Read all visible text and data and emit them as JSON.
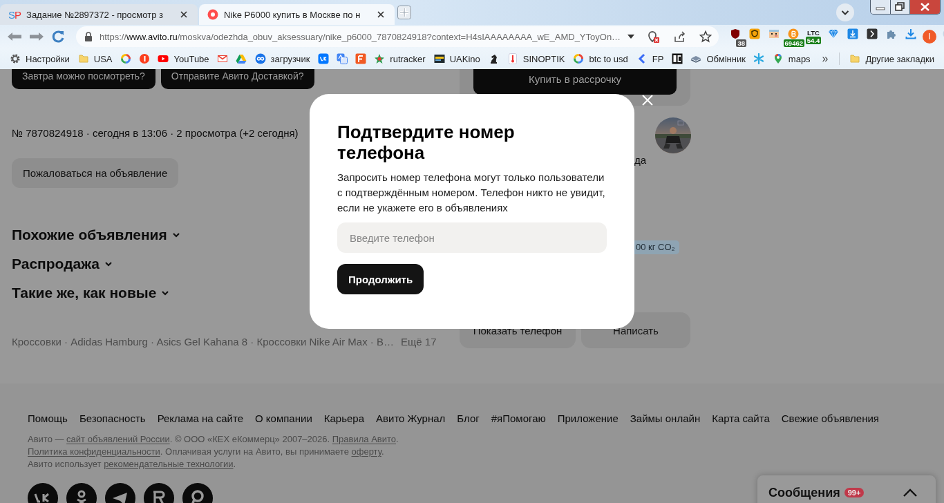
{
  "browser": {
    "tabs": [
      {
        "favicon_text": "SP",
        "title": "Задание №2897372 - просмотр з",
        "selected": false
      },
      {
        "title": "Nike P6000 купить в Москве по н",
        "selected": true
      }
    ],
    "address": {
      "scheme": "https://",
      "host": "www.avito.ru",
      "path": "/moskva/odezhda_obuv_aksessuary/nike_p6000_7870824918?context=H4sIAAAAAAAA_wE_AMD_YToyOn…"
    },
    "extensions": [
      {
        "kind": "badged",
        "badge": "38"
      },
      {
        "kind": "plain"
      },
      {
        "kind": "plain"
      },
      {
        "kind": "badged",
        "badge": "69462"
      },
      {
        "kind": "ticker",
        "label": "LTC",
        "badge": "54.4"
      },
      {
        "kind": "plain"
      },
      {
        "kind": "plain"
      },
      {
        "kind": "plain"
      },
      {
        "kind": "plain"
      },
      {
        "kind": "plain"
      },
      {
        "kind": "profile",
        "label": "I"
      },
      {
        "kind": "plain"
      }
    ],
    "bookmarks": [
      {
        "kind": "link",
        "label": "Настройки"
      },
      {
        "kind": "folder",
        "label": "USA"
      },
      {
        "kind": "icon"
      },
      {
        "kind": "icon"
      },
      {
        "kind": "link",
        "label": "YouTube"
      },
      {
        "kind": "icon"
      },
      {
        "kind": "icon"
      },
      {
        "kind": "link",
        "label": "загрузчик"
      },
      {
        "kind": "icon"
      },
      {
        "kind": "icon"
      },
      {
        "kind": "icon"
      },
      {
        "kind": "link",
        "label": "rutracker"
      },
      {
        "kind": "link",
        "label": "UAKino"
      },
      {
        "kind": "icon"
      },
      {
        "kind": "link",
        "label": "SINOPTIK"
      },
      {
        "kind": "link",
        "label": "btc to usd"
      },
      {
        "kind": "link",
        "label": "FP"
      },
      {
        "kind": "icon"
      },
      {
        "kind": "link",
        "label": "Обмінник"
      },
      {
        "kind": "icon"
      },
      {
        "kind": "link",
        "label": "maps"
      }
    ],
    "bookmarks_overflow": "»",
    "other_bookmarks": "Другие закладки"
  },
  "page": {
    "quick_questions": [
      "Завтра можно посмотреть?",
      "Отправите Авито Доставкой?"
    ],
    "listing_meta": "№ 7870824918 · сегодня в 13:06 · 2 просмотра (+2 сегодня)",
    "report_button": "Пожаловаться на объявление",
    "sections": [
      "Похожие объявления",
      "Распродажа",
      "Такие же, как новые"
    ],
    "tags": "Кроссовки · Adidas Hamburg · Asics Gel Kahana 8 · Кроссовки Nike Air Max · В…",
    "more_tags": "Ещё 17",
    "installment_button": "Купить в рассрочку",
    "seller_fragment": "да",
    "co2_badge": "00 кг CO₂",
    "show_phone_button": "Показать телефон",
    "write_button": "Написать"
  },
  "modal": {
    "title": "Подтвердите номер телефона",
    "text": "Запросить номер телефона могут только пользователи с подтверждённым номером. Телефон никто не увидит, если не укажете его в объявлениях",
    "phone_field": {
      "placeholder": "Введите телефон"
    },
    "continue_button": "Продолжить"
  },
  "footer": {
    "links": [
      "Помощь",
      "Безопасность",
      "Реклама на сайте",
      "О компании",
      "Карьера",
      "Авито Журнал",
      "Блог",
      "#яПомогаю",
      "Приложение",
      "Займы онлайн",
      "Карта сайта",
      "Свежие объявления"
    ],
    "legal": [
      [
        {
          "kind": "text",
          "text": "Авито — "
        },
        {
          "kind": "link",
          "text": "сайт объявлений России"
        },
        {
          "kind": "text",
          "text": ". © ООО «КЕХ еКоммерц» 2007–2026. "
        },
        {
          "kind": "link",
          "text": "Правила Авито"
        },
        {
          "kind": "text",
          "text": "."
        }
      ],
      [
        {
          "kind": "link",
          "text": "Политика конфиденциальности"
        },
        {
          "kind": "text",
          "text": ". Оплачивая услуги на Авито, вы принимаете "
        },
        {
          "kind": "link",
          "text": "оферту"
        },
        {
          "kind": "text",
          "text": "."
        }
      ],
      [
        {
          "kind": "text",
          "text": "Авито использует "
        },
        {
          "kind": "link",
          "text": "рекомендательные технологии"
        },
        {
          "kind": "text",
          "text": "."
        }
      ]
    ]
  },
  "messages": {
    "title": "Сообщения",
    "badge": "99+"
  }
}
